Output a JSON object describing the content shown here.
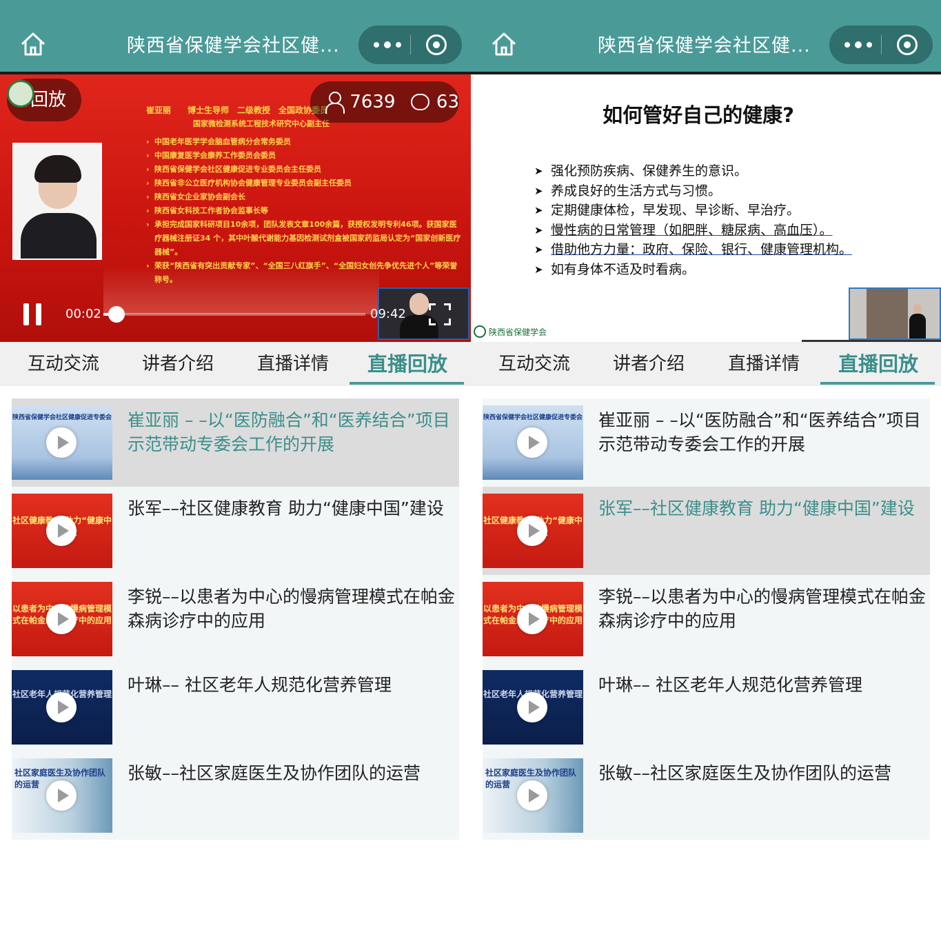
{
  "header": {
    "title": "陕西省保健学会社区健...",
    "home_icon": "home-icon",
    "more_icon": "more-dots-icon",
    "close_icon": "target-close-icon",
    "bg_color": "#4a9a98"
  },
  "video": {
    "replay_badge": "回放",
    "viewers": "7639",
    "comments": "63",
    "current_time": "00:02",
    "total_time": "09:42",
    "progress_fraction": 0.05,
    "bio": {
      "name": "崔亚丽",
      "titles": "博士生导师　二级教授　全国政协委员",
      "sub": "国家微检测系统工程技术研究中心副主任",
      "items": [
        "中国老年医学学会脑血管病分会常务委员",
        "中国康复医学会康养工作委员会委员",
        "陕西省保健学会社区健康促进专业委员会主任委员",
        "陕西省非公立医疗机构协会健康管理专业委员会副主任委员",
        "陕西省女企业家协会副会长",
        "陕西省女科技工作者协会监事长等",
        "承担完成国家科研项目10余项，团队发表文章100余篇，获授权发明专利46项。获国家医疗器械注册证34 个，其中叶酸代谢能力基因检测试剂盒被国家药监局认定为“国家创新医疗器械”。",
        "荣获“陕西省有突出贡献专家”、“全国三八红旗手”、“全国妇女创先争优先进个人”等荣誉称号。"
      ]
    }
  },
  "slide": {
    "title": "如何管好自己的健康?",
    "bullets": [
      "强化预防疾病、保健养生的意识。",
      "养成良好的生活方式与习惯。",
      "定期健康体检，早发现、早诊断、早治疗。",
      "慢性病的日常管理（如肥胖、糖尿病、高血压）。",
      "借助他方力量：政府、保险、银行、健康管理机构。",
      "如有身体不适及时看病。"
    ],
    "footer_logo": "陕西省保健学会"
  },
  "tabs": [
    {
      "label": "互动交流"
    },
    {
      "label": "讲者介绍"
    },
    {
      "label": "直播详情"
    },
    {
      "label": "直播回放"
    }
  ],
  "playlist": [
    {
      "title": "崔亚丽 – –以“医防融合”和“医养结合”项目示范带动专委会工作的开展",
      "thumb_caption": "陕西省保健学会社区健康促进专委会"
    },
    {
      "title": "张军––社区健康教育 助力“健康中国”建设",
      "thumb_caption": "社区健康教育 助力“健康中国”建设"
    },
    {
      "title": "李锐––以患者为中心的慢病管理模式在帕金森病诊疗中的应用",
      "thumb_caption": "以患者为中心的慢病管理模式在帕金森病诊疗中的应用"
    },
    {
      "title": "叶琳–– 社区老年人规范化营养管理",
      "thumb_caption": "社区老年人规范化营养管理"
    },
    {
      "title": "张敏––社区家庭医生及协作团队的运营",
      "thumb_caption": "社区家庭医生及协作团队的运营"
    }
  ]
}
